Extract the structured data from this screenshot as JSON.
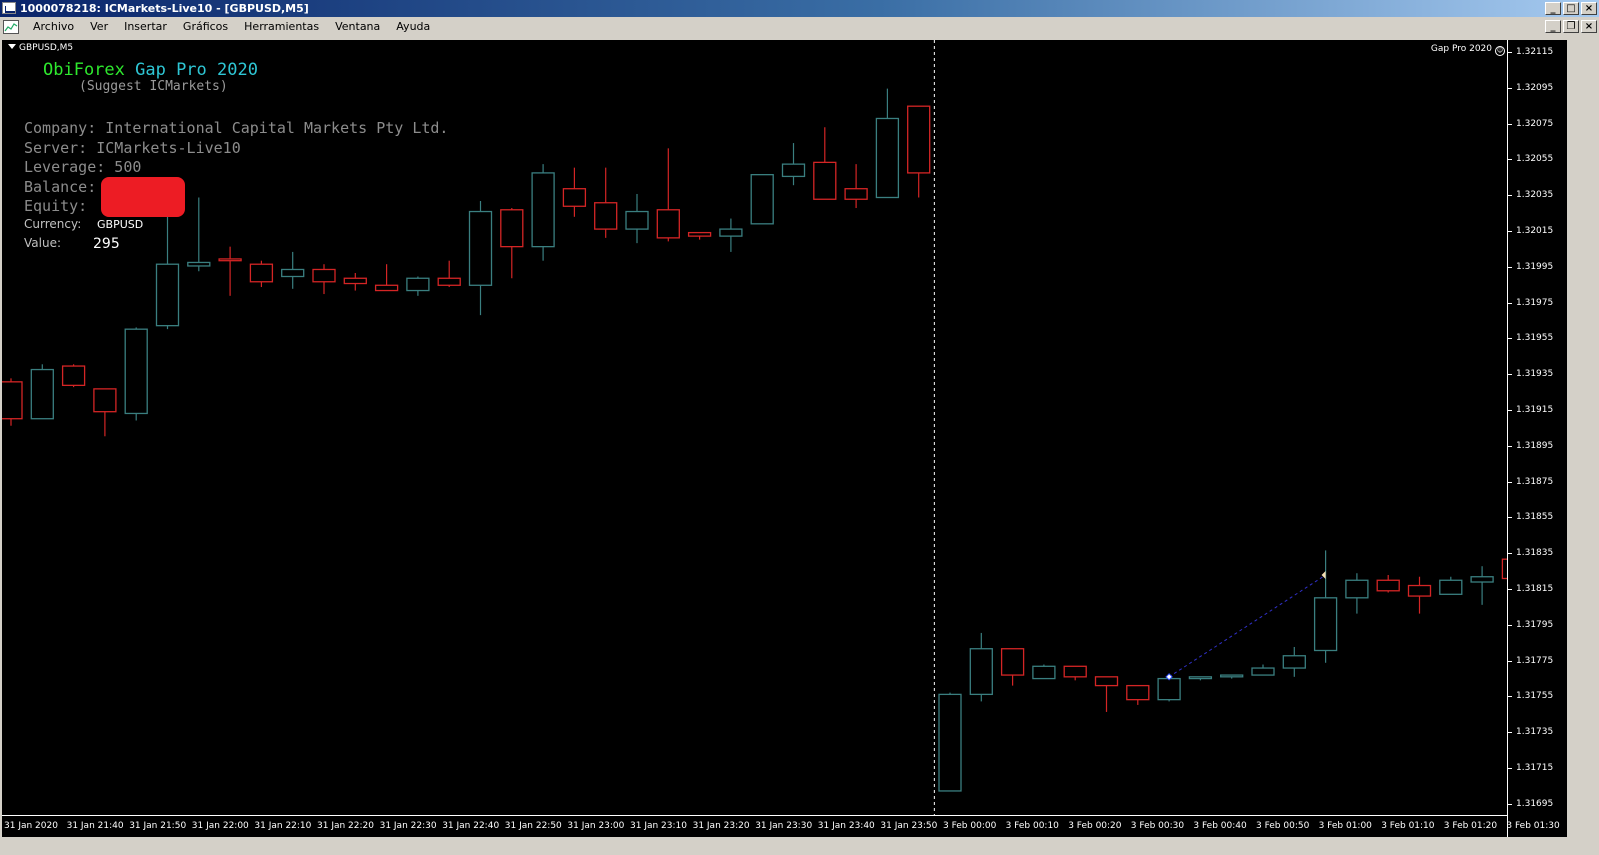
{
  "window": {
    "title": "1000078218: ICMarkets-Live10 - [GBPUSD,M5]"
  },
  "menu": {
    "items": [
      "Archivo",
      "Ver",
      "Insertar",
      "Gráficos",
      "Herramientas",
      "Ventana",
      "Ayuda"
    ]
  },
  "chart_header": {
    "symbol": "GBPUSD,M5",
    "indicator": "Gap Pro 2020"
  },
  "panel": {
    "title_part1": "ObiForex",
    "title_part2": " Gap Pro 2020",
    "subtitle": "(Suggest ICMarkets)",
    "company": "Company: International Capital Markets Pty Ltd.",
    "server": "Server: ICMarkets-Live10",
    "leverage": "Leverage: 500",
    "balance": "Balance:",
    "equity": "Equity:",
    "currency_label": "Currency:",
    "currency_value": "GBPUSD",
    "value_label": "Value:",
    "value_value": "295"
  },
  "colors": {
    "bull": "#3a7f80",
    "bear": "#d42525",
    "background": "#000000",
    "period_separator": "#ffffff",
    "gap_line": "#3030c8",
    "redaction": "#ed1c24"
  },
  "chart_data": {
    "type": "candlestick",
    "symbol": "GBPUSD",
    "timeframe": "M5",
    "price_axis_labels": [
      "1.32115",
      "1.32095",
      "1.32075",
      "1.32055",
      "1.32035",
      "1.32015",
      "1.31995",
      "1.31975",
      "1.31955",
      "1.31935",
      "1.31915",
      "1.31895",
      "1.31875",
      "1.31855",
      "1.31835",
      "1.31815",
      "1.31795",
      "1.31775",
      "1.31755",
      "1.31735",
      "1.31715",
      "1.31695"
    ],
    "time_axis_labels": [
      "31 Jan 2020",
      "31 Jan 21:40",
      "31 Jan 21:50",
      "31 Jan 22:00",
      "31 Jan 22:10",
      "31 Jan 22:20",
      "31 Jan 22:30",
      "31 Jan 22:40",
      "31 Jan 22:50",
      "31 Jan 23:00",
      "31 Jan 23:10",
      "31 Jan 23:20",
      "31 Jan 23:30",
      "31 Jan 23:40",
      "31 Jan 23:50",
      "3 Feb 00:00",
      "3 Feb 00:10",
      "3 Feb 00:20",
      "3 Feb 00:30",
      "3 Feb 00:40",
      "3 Feb 00:50",
      "3 Feb 01:00",
      "3 Feb 01:10",
      "3 Feb 01:20",
      "3 Feb 01:30"
    ],
    "ylim": [
      1.31692,
      1.32122
    ],
    "candles": [
      {
        "o": 1.31933,
        "h": 1.31935,
        "l": 1.31908,
        "c": 1.31912
      },
      {
        "o": 1.31912,
        "h": 1.31943,
        "l": 1.31912,
        "c": 1.3194
      },
      {
        "o": 1.31942,
        "h": 1.31943,
        "l": 1.3193,
        "c": 1.31931
      },
      {
        "o": 1.31929,
        "h": 1.31929,
        "l": 1.31902,
        "c": 1.31916
      },
      {
        "o": 1.31915,
        "h": 1.31964,
        "l": 1.31911,
        "c": 1.31963
      },
      {
        "o": 1.31965,
        "h": 1.3204,
        "l": 1.31963,
        "c": 1.32
      },
      {
        "o": 1.31999,
        "h": 1.32038,
        "l": 1.31996,
        "c": 1.32001
      },
      {
        "o": 1.32003,
        "h": 1.3201,
        "l": 1.31982,
        "c": 1.32002
      },
      {
        "o": 1.32,
        "h": 1.32002,
        "l": 1.31987,
        "c": 1.3199
      },
      {
        "o": 1.31993,
        "h": 1.32007,
        "l": 1.31986,
        "c": 1.31997
      },
      {
        "o": 1.31997,
        "h": 1.32,
        "l": 1.31983,
        "c": 1.3199
      },
      {
        "o": 1.31992,
        "h": 1.31995,
        "l": 1.31985,
        "c": 1.31989
      },
      {
        "o": 1.31988,
        "h": 1.32,
        "l": 1.31985,
        "c": 1.31985
      },
      {
        "o": 1.31985,
        "h": 1.31993,
        "l": 1.31982,
        "c": 1.31992
      },
      {
        "o": 1.31992,
        "h": 1.32002,
        "l": 1.31987,
        "c": 1.31988
      },
      {
        "o": 1.31988,
        "h": 1.32036,
        "l": 1.31971,
        "c": 1.3203
      },
      {
        "o": 1.32031,
        "h": 1.32032,
        "l": 1.31992,
        "c": 1.3201
      },
      {
        "o": 1.3201,
        "h": 1.32057,
        "l": 1.32002,
        "c": 1.32052
      },
      {
        "o": 1.32043,
        "h": 1.32055,
        "l": 1.32027,
        "c": 1.32033
      },
      {
        "o": 1.32035,
        "h": 1.32055,
        "l": 1.32015,
        "c": 1.3202
      },
      {
        "o": 1.3202,
        "h": 1.3204,
        "l": 1.32012,
        "c": 1.3203
      },
      {
        "o": 1.32031,
        "h": 1.32066,
        "l": 1.32013,
        "c": 1.32015
      },
      {
        "o": 1.32018,
        "h": 1.32018,
        "l": 1.32014,
        "c": 1.32016
      },
      {
        "o": 1.32016,
        "h": 1.32026,
        "l": 1.32007,
        "c": 1.3202
      },
      {
        "o": 1.32023,
        "h": 1.32051,
        "l": 1.32023,
        "c": 1.32051
      },
      {
        "o": 1.3205,
        "h": 1.32069,
        "l": 1.32045,
        "c": 1.32057
      },
      {
        "o": 1.32058,
        "h": 1.32078,
        "l": 1.32037,
        "c": 1.32037
      },
      {
        "o": 1.32043,
        "h": 1.32057,
        "l": 1.32032,
        "c": 1.32037
      },
      {
        "o": 1.32038,
        "h": 1.321,
        "l": 1.32038,
        "c": 1.32083
      },
      {
        "o": 1.3209,
        "h": 1.3209,
        "l": 1.32038,
        "c": 1.32052
      },
      {
        "o": 1.317,
        "h": 1.31756,
        "l": 1.317,
        "c": 1.31755
      },
      {
        "o": 1.31755,
        "h": 1.3179,
        "l": 1.31751,
        "c": 1.31781
      },
      {
        "o": 1.31781,
        "h": 1.31781,
        "l": 1.3176,
        "c": 1.31766
      },
      {
        "o": 1.31764,
        "h": 1.31772,
        "l": 1.31764,
        "c": 1.31771
      },
      {
        "o": 1.31771,
        "h": 1.31771,
        "l": 1.31763,
        "c": 1.31765
      },
      {
        "o": 1.31765,
        "h": 1.31765,
        "l": 1.31745,
        "c": 1.3176
      },
      {
        "o": 1.3176,
        "h": 1.3176,
        "l": 1.31749,
        "c": 1.31752
      },
      {
        "o": 1.31752,
        "h": 1.31765,
        "l": 1.31751,
        "c": 1.31764
      },
      {
        "o": 1.31764,
        "h": 1.31765,
        "l": 1.31763,
        "c": 1.31765
      },
      {
        "o": 1.31765,
        "h": 1.31766,
        "l": 1.31764,
        "c": 1.31766
      },
      {
        "o": 1.31766,
        "h": 1.31772,
        "l": 1.31766,
        "c": 1.3177
      },
      {
        "o": 1.3177,
        "h": 1.31782,
        "l": 1.31765,
        "c": 1.31777
      },
      {
        "o": 1.3178,
        "h": 1.31837,
        "l": 1.31773,
        "c": 1.3181
      },
      {
        "o": 1.3181,
        "h": 1.31824,
        "l": 1.31801,
        "c": 1.3182
      },
      {
        "o": 1.3182,
        "h": 1.31823,
        "l": 1.31813,
        "c": 1.31814
      },
      {
        "o": 1.31817,
        "h": 1.31822,
        "l": 1.31801,
        "c": 1.31811
      },
      {
        "o": 1.31812,
        "h": 1.31822,
        "l": 1.31812,
        "c": 1.3182
      },
      {
        "o": 1.31819,
        "h": 1.31828,
        "l": 1.31806,
        "c": 1.31822
      },
      {
        "o": 1.31832,
        "h": 1.31832,
        "l": 1.3182,
        "c": 1.31821
      }
    ],
    "gap_line": {
      "from_price": 1.31765,
      "to_price": 1.31823
    }
  }
}
